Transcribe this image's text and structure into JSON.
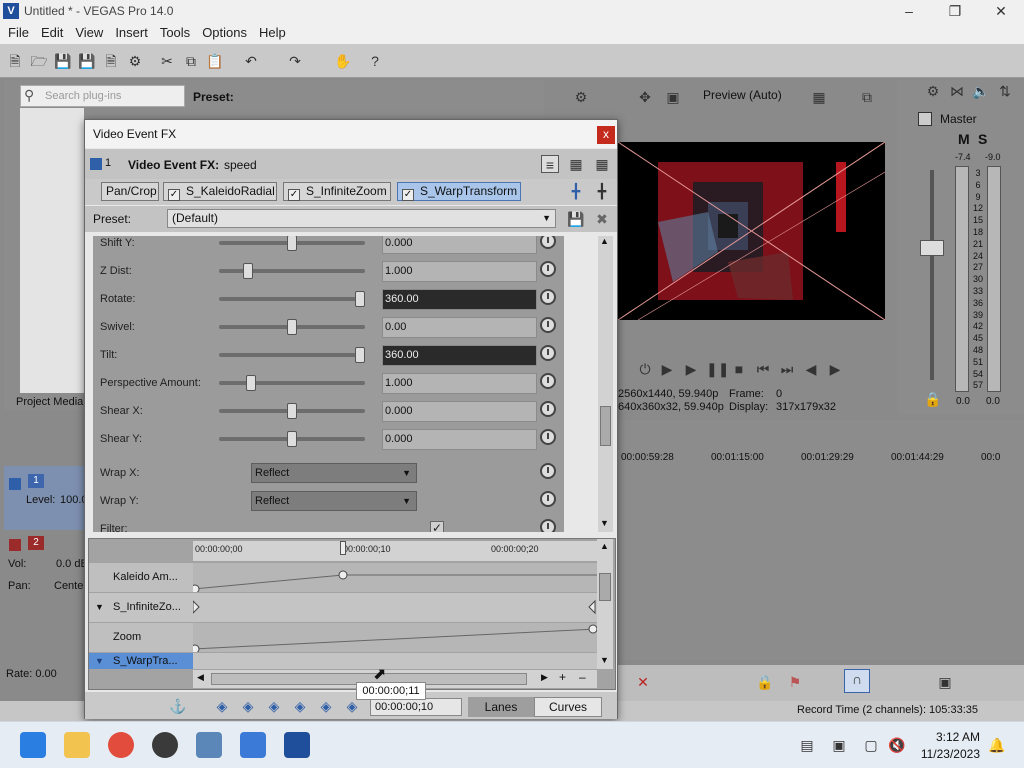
{
  "window": {
    "title": "Untitled * - VEGAS Pro 14.0"
  },
  "menu": [
    "File",
    "Edit",
    "View",
    "Insert",
    "Tools",
    "Options",
    "Help"
  ],
  "plugins": {
    "search_placeholder": "Search plug-ins",
    "preset_label": "Preset:",
    "tab_label": "Project Media"
  },
  "preview": {
    "mode": "Preview (Auto)",
    "project": "2560x1440, 59.940p",
    "preview_res": "640x360x32, 59.940p",
    "frame_label": "Frame:",
    "frame_value": "0",
    "display_label": "Display:",
    "display_value": "317x179x32"
  },
  "master": {
    "label": "Master",
    "peak_left": "-7.4",
    "peak_right": "-9.0",
    "scale": [
      "3",
      "6",
      "9",
      "12",
      "15",
      "18",
      "21",
      "24",
      "27",
      "30",
      "33",
      "36",
      "39",
      "42",
      "45",
      "48",
      "51",
      "54",
      "57"
    ],
    "bottom_left": "0.0",
    "bottom_right": "0.0",
    "buttons": [
      "M",
      "S"
    ]
  },
  "tracks": [
    {
      "number": "1",
      "level_label": "Level:",
      "level_value": "100.0"
    },
    {
      "number": "2",
      "vol_label": "Vol:",
      "vol_value": "0.0 dB",
      "pan_label": "Pan:",
      "pan_value": "Center"
    }
  ],
  "rate": "Rate: 0.00",
  "timeline": {
    "ticks": [
      "00:00:59:28",
      "00:01:15:00",
      "00:01:29:29",
      "00:01:44:29",
      "00:0"
    ]
  },
  "status": {
    "record_time": "Record Time (2 channels): 105:33:35"
  },
  "dialog": {
    "title": "Video Event FX",
    "close": "x",
    "fx_number": "1",
    "fx_label": "Video Event FX:",
    "fx_name": "speed",
    "chain": [
      {
        "label": "Pan/Crop",
        "checkbox": false,
        "active": false
      },
      {
        "label": "S_KaleidoRadial",
        "checkbox": true,
        "active": false
      },
      {
        "label": "S_InfiniteZoom",
        "checkbox": true,
        "active": false
      },
      {
        "label": "S_WarpTransform",
        "checkbox": true,
        "active": true
      }
    ],
    "preset_label": "Preset:",
    "preset_value": "(Default)",
    "params": [
      {
        "label": "Shift Y:",
        "value": "0.000",
        "level": 0.5
      },
      {
        "label": "Z Dist:",
        "value": "1.000",
        "level": 0.18
      },
      {
        "label": "Rotate:",
        "value": "360.00",
        "level": 1.0,
        "dark": true
      },
      {
        "label": "Swivel:",
        "value": "0.00",
        "level": 0.5
      },
      {
        "label": "Tilt:",
        "value": "360.00",
        "level": 1.0,
        "dark": true
      },
      {
        "label": "Perspective Amount:",
        "value": "1.000",
        "level": 0.2
      },
      {
        "label": "Shear X:",
        "value": "0.000",
        "level": 0.5
      },
      {
        "label": "Shear Y:",
        "value": "0.000",
        "level": 0.5
      }
    ],
    "wrap_x_label": "Wrap X:",
    "wrap_x_value": "Reflect",
    "wrap_y_label": "Wrap Y:",
    "wrap_y_value": "Reflect",
    "filter_label": "Filter:",
    "kf_ruler": [
      "00:00:00;00",
      "00:00:00;10",
      "00:00:00;20"
    ],
    "kf_rows": [
      "Kaleido Am...",
      "S_InfiniteZo...",
      "Zoom",
      "S_WarpTra..."
    ],
    "timecode": "00:00:00;10",
    "tooltip": "00:00:00;11",
    "lanes": "Lanes",
    "curves": "Curves"
  },
  "taskbar": {
    "time": "3:12 AM",
    "date": "11/23/2023"
  },
  "colors": {
    "accent": "#1f4e9b",
    "active_fx": "#a9c6ea",
    "close": "#c42b1c"
  }
}
